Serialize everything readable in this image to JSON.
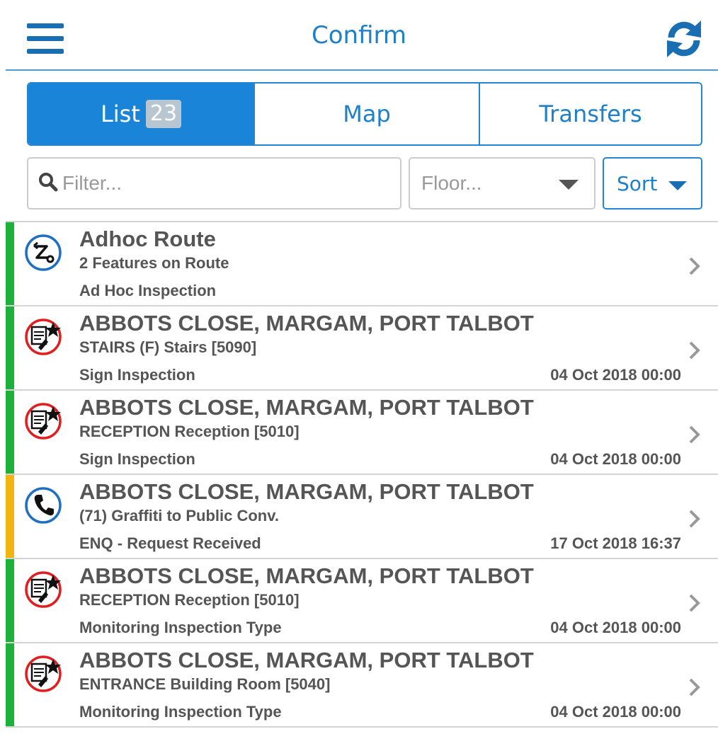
{
  "header": {
    "title": "Confirm",
    "menu_icon": "hamburger-menu-icon",
    "refresh_icon": "refresh-icon",
    "accent_color": "#1f80c9"
  },
  "tabs": [
    {
      "label": "List",
      "badge": "23",
      "active": true
    },
    {
      "label": "Map",
      "active": false
    },
    {
      "label": "Transfers",
      "active": false
    }
  ],
  "filter": {
    "placeholder": "Filter...",
    "value": "",
    "icon": "search-icon"
  },
  "floor": {
    "placeholder": "Floor..."
  },
  "sort": {
    "label": "Sort"
  },
  "status_colors": {
    "green": "#1bb13a",
    "amber": "#f2b510"
  },
  "items": [
    {
      "title": "Adhoc Route",
      "subtitle": "2 Features on Route",
      "type": "Ad Hoc Inspection",
      "date": "",
      "icon": "adhoc-route-icon",
      "status_color": "#1bb13a"
    },
    {
      "title": "ABBOTS CLOSE, MARGAM, PORT TALBOT",
      "subtitle": "STAIRS (F) Stairs [5090]",
      "type": "Sign Inspection",
      "date": "04 Oct 2018 00:00",
      "icon": "inspection-icon",
      "status_color": "#1bb13a"
    },
    {
      "title": "ABBOTS CLOSE, MARGAM, PORT TALBOT",
      "subtitle": "RECEPTION Reception [5010]",
      "type": "Sign Inspection",
      "date": "04 Oct 2018 00:00",
      "icon": "inspection-icon",
      "status_color": "#1bb13a"
    },
    {
      "title": "ABBOTS CLOSE, MARGAM, PORT TALBOT",
      "subtitle": "(71) Graffiti to Public Conv.",
      "type": "ENQ - Request Received",
      "date": "17 Oct 2018 16:37",
      "icon": "phone-enquiry-icon",
      "status_color": "#f2b510"
    },
    {
      "title": "ABBOTS CLOSE, MARGAM, PORT TALBOT",
      "subtitle": "RECEPTION Reception [5010]",
      "type": "Monitoring Inspection Type",
      "date": "04 Oct 2018 00:00",
      "icon": "inspection-icon",
      "status_color": "#1bb13a"
    },
    {
      "title": "ABBOTS CLOSE, MARGAM, PORT TALBOT",
      "subtitle": "ENTRANCE Building Room [5040]",
      "type": "Monitoring Inspection Type",
      "date": "04 Oct 2018 00:00",
      "icon": "inspection-icon",
      "status_color": "#1bb13a"
    }
  ]
}
